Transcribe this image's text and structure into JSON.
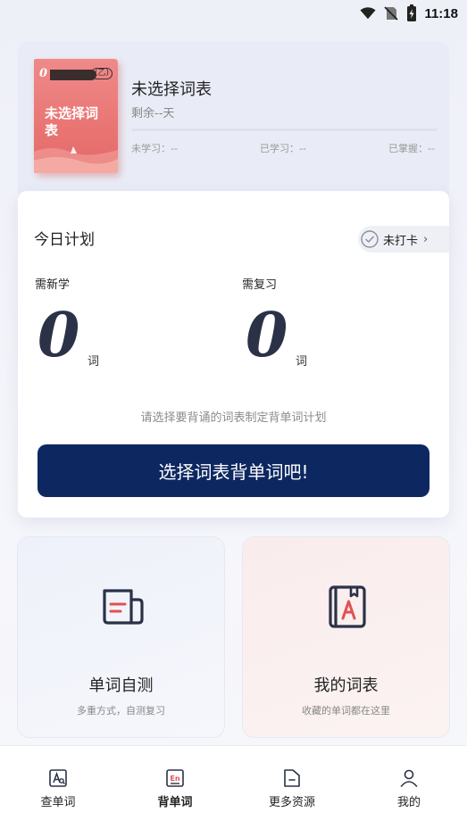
{
  "status_bar": {
    "time": "11:18"
  },
  "book": {
    "cover_number": "0",
    "cover_badge": "(乙)",
    "cover_title": "未选择词表",
    "name": "未选择词表",
    "remaining": "剩余--天",
    "progress": 0,
    "stats": [
      {
        "label": "未学习：--"
      },
      {
        "label": "已学习：--"
      },
      {
        "label": "已掌握：--"
      }
    ]
  },
  "plan": {
    "title": "今日计划",
    "checkin_label": "未打卡",
    "new_label": "需新学",
    "new_count": "0",
    "review_label": "需复习",
    "review_count": "0",
    "unit": "词",
    "hint": "请选择要背诵的词表制定背单词计划",
    "cta_label": "选择词表背单词吧!"
  },
  "features": [
    {
      "title": "单词自测",
      "subtitle": "多重方式，自测复习",
      "icon": "newspaper-icon"
    },
    {
      "title": "我的词表",
      "subtitle": "收藏的单词都在这里",
      "icon": "wordbook-icon"
    }
  ],
  "nav": [
    {
      "label": "查单词",
      "icon": "lookup-icon",
      "active": false
    },
    {
      "label": "背单词",
      "icon": "memorize-icon",
      "active": true
    },
    {
      "label": "更多资源",
      "icon": "folder-icon",
      "active": false
    },
    {
      "label": "我的",
      "icon": "profile-icon",
      "active": false
    }
  ],
  "colors": {
    "accent": "#0d2861",
    "cover": "#e97573",
    "wordbook_accent": "#e05252"
  }
}
